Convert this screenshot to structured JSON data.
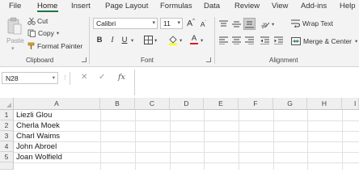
{
  "menu": {
    "tabs": [
      "File",
      "Home",
      "Insert",
      "Page Layout",
      "Formulas",
      "Data",
      "Review",
      "View",
      "Add-ins",
      "Help"
    ],
    "active": "Home"
  },
  "ribbon": {
    "clipboard": {
      "paste_label": "Paste",
      "cut_label": "Cut",
      "copy_label": "Copy",
      "format_painter_label": "Format Painter",
      "group_label": "Clipboard"
    },
    "font": {
      "font_name": "Calibri",
      "font_size": "11",
      "grow_label": "A",
      "shrink_label": "A",
      "bold": "B",
      "italic": "I",
      "underline": "U",
      "font_color_label": "A",
      "highlight_color": "#ffff00",
      "font_color": "#e81123",
      "group_label": "Font"
    },
    "alignment": {
      "wrap_text_label": "Wrap Text",
      "merge_center_label": "Merge & Center",
      "group_label": "Alignment"
    }
  },
  "formula_bar": {
    "name_box": "N28",
    "formula": ""
  },
  "grid": {
    "columns": [
      "A",
      "B",
      "C",
      "D",
      "E",
      "F",
      "G",
      "H",
      "I"
    ],
    "rows": [
      "1",
      "2",
      "3",
      "4",
      "5"
    ],
    "cells": [
      "Liezli Glou",
      "Cherla Moek",
      "Charl Waims",
      "John Abroel",
      "Joan Wolfield"
    ]
  },
  "colors": {
    "accent": "#217346",
    "ribbon_bg": "#f3f3f3"
  }
}
